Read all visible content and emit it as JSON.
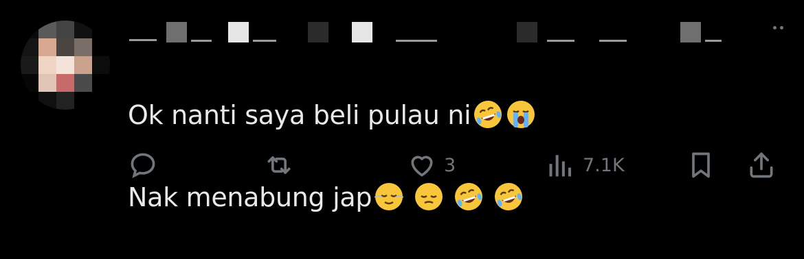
{
  "tweet": {
    "line1": "Ok nanti saya beli pulau ni",
    "line2": "Nak menabung jap"
  },
  "actions": {
    "reply_count": "",
    "retweet_count": "",
    "like_count": "3",
    "view_count": "7.1K"
  },
  "icons": {
    "reply": "reply-icon",
    "retweet": "retweet-icon",
    "like": "heart-icon",
    "views": "analytics-icon",
    "bookmark": "bookmark-icon",
    "share": "share-icon",
    "more": "more-icon"
  },
  "colors": {
    "background": "#000000",
    "text": "#e7e9ea",
    "muted": "#71767b"
  }
}
